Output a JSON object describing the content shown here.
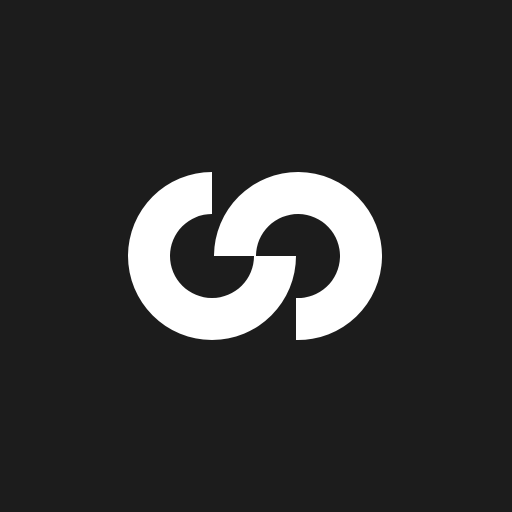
{
  "icon": {
    "name": "interlocking-rings-logo-icon",
    "background_color": "#1c1c1c",
    "foreground_color": "#ffffff"
  }
}
